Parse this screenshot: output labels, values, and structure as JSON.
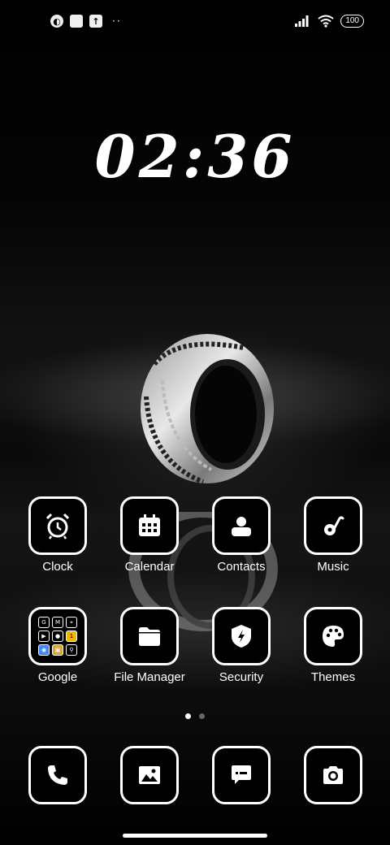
{
  "status": {
    "battery": "100",
    "left_icons": [
      "notification-app-icon",
      "square-notification-icon",
      "upload-notification-icon"
    ],
    "more_indicator": "··"
  },
  "clock": {
    "time": "02:36"
  },
  "apps_row1": [
    {
      "label": "Clock",
      "icon": "alarm-clock-icon"
    },
    {
      "label": "Calendar",
      "icon": "calendar-icon"
    },
    {
      "label": "Contacts",
      "icon": "contacts-icon"
    },
    {
      "label": "Music",
      "icon": "music-icon"
    }
  ],
  "apps_row2": [
    {
      "label": "Google",
      "icon": "google-folder-icon"
    },
    {
      "label": "File Manager",
      "icon": "folder-icon"
    },
    {
      "label": "Security",
      "icon": "shield-icon"
    },
    {
      "label": "Themes",
      "icon": "palette-icon"
    }
  ],
  "folder": {
    "tiles": [
      "G",
      "M",
      "⌖",
      "▶",
      "●",
      "1",
      "◉",
      "▣",
      "⚲"
    ]
  },
  "dock": [
    "phone-icon",
    "gallery-icon",
    "messages-icon",
    "camera-icon"
  ],
  "page_indicator": {
    "pages": 2,
    "current": 1
  }
}
